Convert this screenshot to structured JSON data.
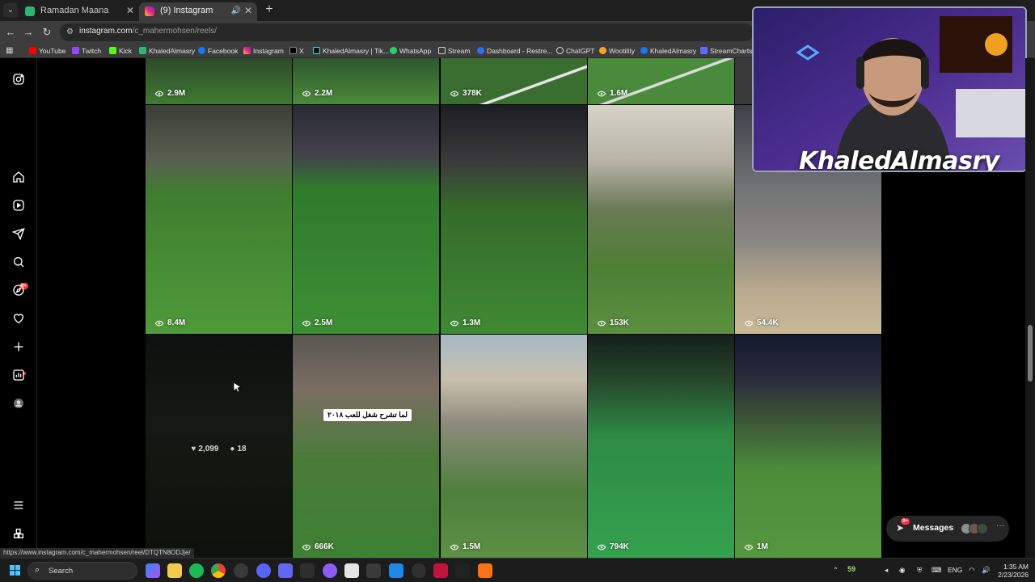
{
  "browser": {
    "tabs": [
      {
        "title": "Ramadan Maana",
        "active": false
      },
      {
        "title": "(9) Instagram",
        "active": true
      }
    ],
    "url_host": "instagram.com",
    "url_path": "/c_mahermohsen/reels/",
    "bookmarks": [
      "YouTube",
      "Twitch",
      "Kick",
      "KhaledAlmasry",
      "Facebook",
      "Instagram",
      "X",
      "KhaledAlmasry | Tik...",
      "WhatsApp",
      "Stream",
      "Dashboard - Restre...",
      "ChatGPT",
      "Wootility",
      "KhaledAlmasry",
      "StreamCharts"
    ],
    "status_url": "https://www.instagram.com/c_mahermohsen/reel/DTQTN8ODJje/"
  },
  "instagram": {
    "notification_badge": "9+",
    "reels": [
      {
        "views": "2.9M"
      },
      {
        "views": "2.2M"
      },
      {
        "views": "378K"
      },
      {
        "views": "1.6M"
      },
      {
        "views": ""
      },
      {
        "views": "8.4M"
      },
      {
        "views": "2.5M"
      },
      {
        "views": "1.3M"
      },
      {
        "views": "153K"
      },
      {
        "views": "54.4K"
      },
      {
        "views": "",
        "likes": "2,099",
        "comments": "18"
      },
      {
        "views": "666K",
        "caption": "لما تشرح شغل للعب ٢٠١٨"
      },
      {
        "views": "1.5M"
      },
      {
        "views": "794K"
      },
      {
        "views": "1M"
      }
    ],
    "messages": {
      "label": "Messages",
      "badge": "9+"
    }
  },
  "webcam": {
    "name": "KhaledAlmasry"
  },
  "taskbar": {
    "search_label": "Search",
    "temperature": "59",
    "language": "ENG",
    "time": "1:35 AM",
    "date": "2/23/2026"
  },
  "colors": {
    "accent_notification": "#ff3040",
    "instagram_bg": "#000000",
    "chrome_toolbar": "#3c3c3c"
  }
}
